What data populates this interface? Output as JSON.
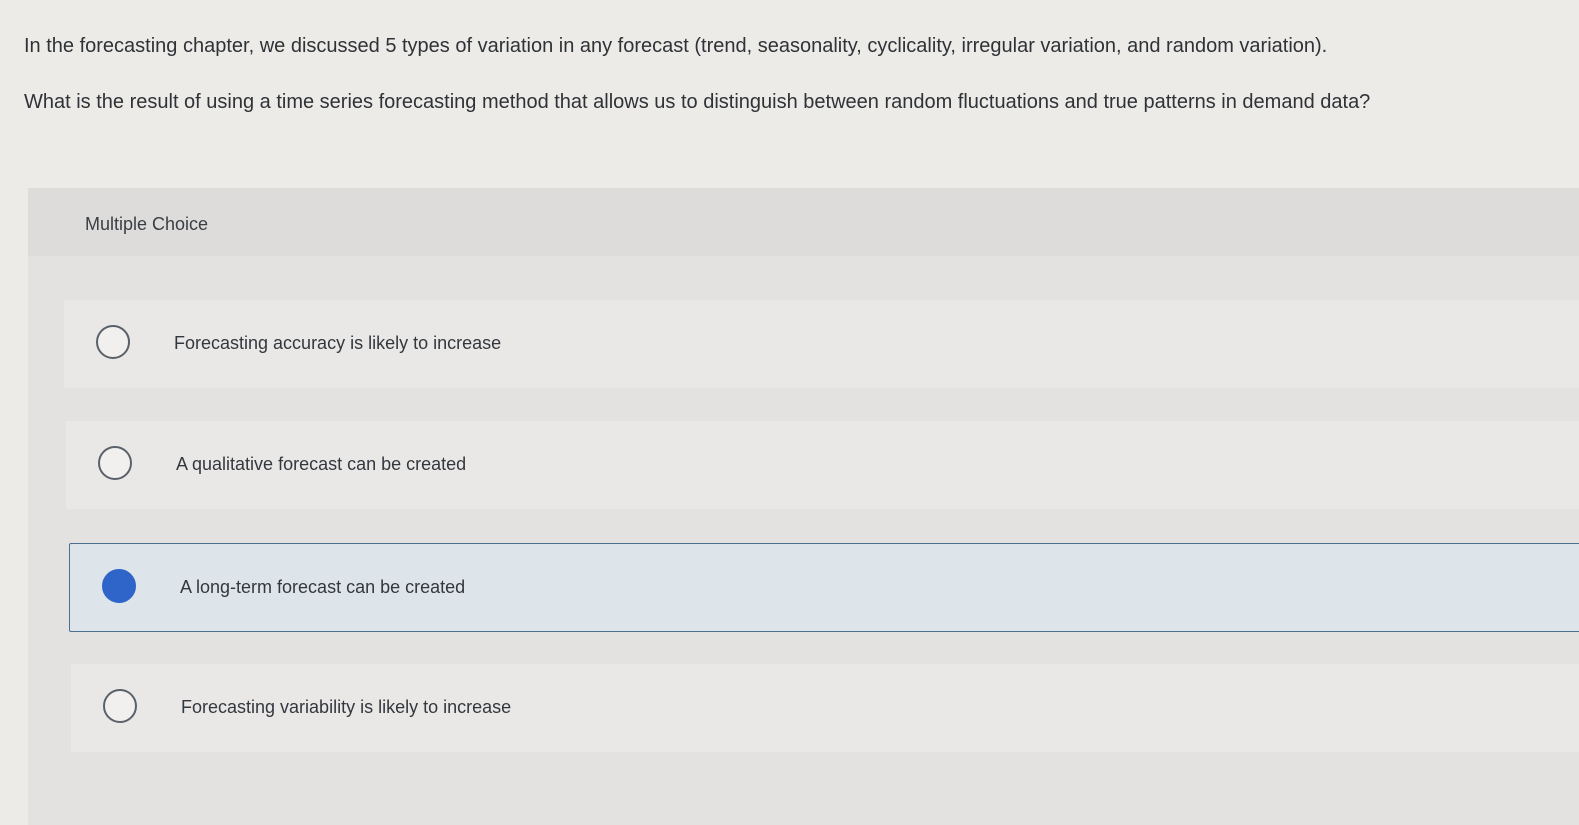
{
  "question": {
    "line1": "In the forecasting chapter, we discussed 5 types of variation in any forecast (trend, seasonality, cyclicality, irregular variation, and random variation).",
    "line2": "What is the result of using a time series forecasting method that allows us to distinguish between random fluctuations and true patterns in demand data?"
  },
  "multiple_choice": {
    "title": "Multiple Choice",
    "options": [
      {
        "label": "Forecasting accuracy is likely to increase",
        "selected": false
      },
      {
        "label": "A qualitative forecast can be created",
        "selected": false
      },
      {
        "label": "A long-term forecast can be created",
        "selected": true
      },
      {
        "label": "Forecasting variability is likely to increase",
        "selected": false
      }
    ]
  },
  "colors": {
    "selected_radio": "#2f64c9",
    "selected_border": "#4a6f92",
    "selected_background": "#dde4ea"
  }
}
